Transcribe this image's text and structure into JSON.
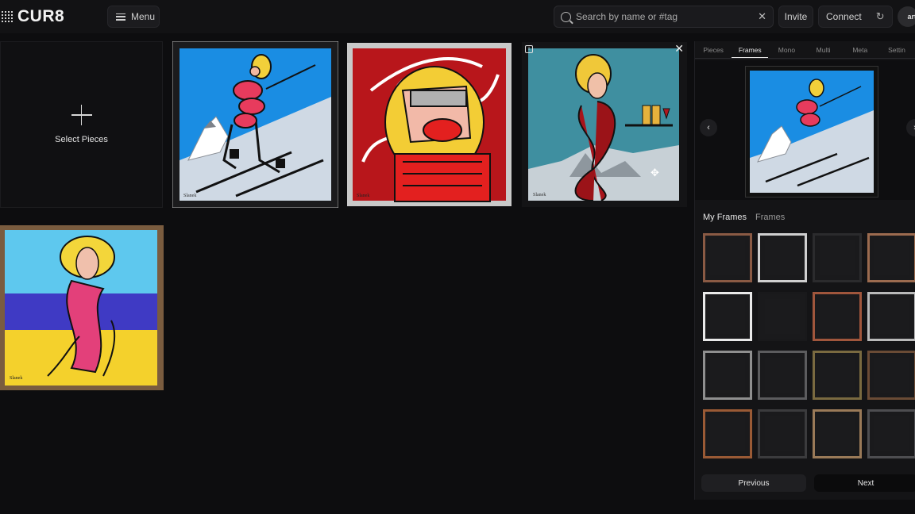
{
  "app": {
    "logo": "CUR8"
  },
  "header": {
    "menu_label": "Menu",
    "search_placeholder": "Search by name or #tag",
    "invite_label": "Invite",
    "connect_label": "Connect",
    "avatar_text": "art"
  },
  "canvas": {
    "select_label": "Select Pieces"
  },
  "panel": {
    "tabs": [
      {
        "label": "Pieces"
      },
      {
        "label": "Frames"
      },
      {
        "label": "Mono"
      },
      {
        "label": "Multi"
      },
      {
        "label": "Meta"
      },
      {
        "label": "Settin"
      }
    ],
    "active_tab": "Frames",
    "subtabs": [
      {
        "label": "My Frames"
      },
      {
        "label": "Frames"
      }
    ],
    "prev_label": "Previous",
    "next_label": "Next",
    "frames": [
      {
        "style": "copper-thin",
        "color": "#8a5a44"
      },
      {
        "style": "silver-thin",
        "color": "#cfcfcf"
      },
      {
        "style": "black",
        "color": "#2b2b2d"
      },
      {
        "style": "copper",
        "color": "#9c6b4f"
      },
      {
        "style": "white",
        "color": "#e9e9e9"
      },
      {
        "style": "dark",
        "color": "#19191b"
      },
      {
        "style": "rose-copper",
        "color": "#a0563c"
      },
      {
        "style": "silver-ornate",
        "color": "#b9b9b9"
      },
      {
        "style": "marble",
        "color": "#8f8f8f"
      },
      {
        "style": "grey-thin",
        "color": "#5c5c5e"
      },
      {
        "style": "gold-thin",
        "color": "#7a6a40"
      },
      {
        "style": "bronze",
        "color": "#6a4b35"
      },
      {
        "style": "copper-wood",
        "color": "#9a5a35"
      },
      {
        "style": "charcoal",
        "color": "#3b3b3d"
      },
      {
        "style": "gold-wood",
        "color": "#9a7a58"
      },
      {
        "style": "graphite",
        "color": "#4d4d50"
      }
    ]
  }
}
